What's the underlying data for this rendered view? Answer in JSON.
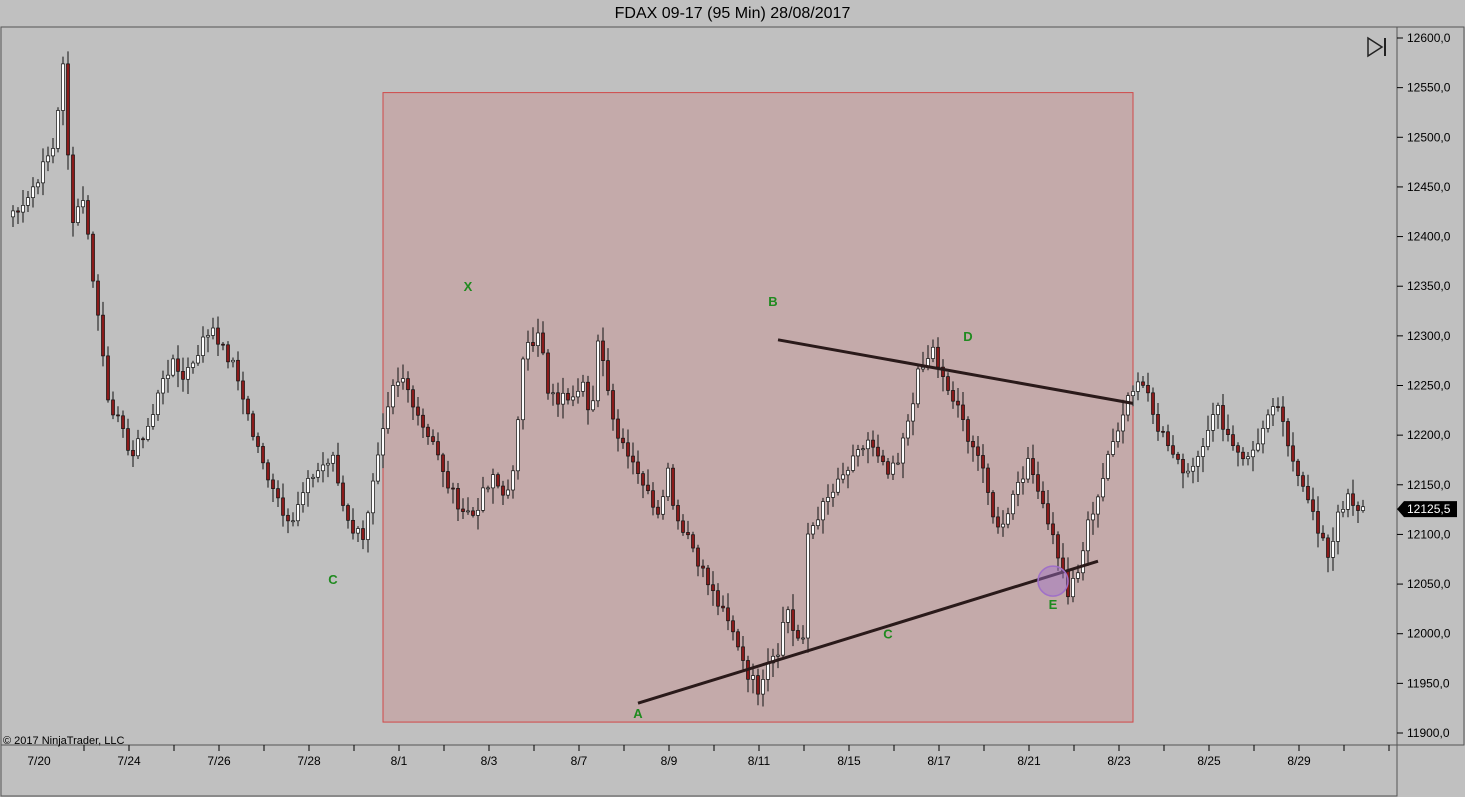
{
  "window": {
    "title": "FDAX 09-17 (95 Min)  28/08/2017"
  },
  "footer": {
    "copyright": "© 2017 NinjaTrader, LLC"
  },
  "icons": {
    "play_end": "skip-to-end-icon"
  },
  "colors": {
    "background": "#c0c0c0",
    "zone_fill": "#c4aaaa",
    "zone_border": "#d04848",
    "candle_up": "#ffffff",
    "candle_down": "#8b1a1a",
    "trendline": "#2a1a1a",
    "wave_label": "#1f8a1f",
    "marker": "#a070c8"
  },
  "chart_data": {
    "type": "candlestick",
    "title": "FDAX 09-17 (95 Min)  28/08/2017",
    "ylim": [
      11890,
      12615
    ],
    "yticks": [
      "12600,0",
      "12550,0",
      "12500,0",
      "12450,0",
      "12400,0",
      "12350,0",
      "12300,0",
      "12250,0",
      "12200,0",
      "12150,0",
      "12100,0",
      "12050,0",
      "12000,0",
      "11950,0",
      "11900,0"
    ],
    "ytick_values": [
      12600,
      12550,
      12500,
      12450,
      12400,
      12350,
      12300,
      12250,
      12200,
      12150,
      12100,
      12050,
      12000,
      11950,
      11900
    ],
    "xticks": [
      "7/20",
      "7/24",
      "7/26",
      "7/28",
      "8/1",
      "8/3",
      "8/7",
      "8/9",
      "8/11",
      "8/15",
      "8/17",
      "8/21",
      "8/23",
      "8/25",
      "8/29"
    ],
    "last_price": "12125,5",
    "grid": false,
    "price_path": [
      [
        0,
        12420
      ],
      [
        4,
        12440
      ],
      [
        7,
        12470
      ],
      [
        9,
        12490
      ],
      [
        10,
        12530
      ],
      [
        11,
        12570
      ],
      [
        12,
        12480
      ],
      [
        13,
        12420
      ],
      [
        15,
        12440
      ],
      [
        17,
        12360
      ],
      [
        18,
        12320
      ],
      [
        20,
        12240
      ],
      [
        23,
        12200
      ],
      [
        25,
        12180
      ],
      [
        27,
        12200
      ],
      [
        29,
        12220
      ],
      [
        31,
        12260
      ],
      [
        33,
        12270
      ],
      [
        35,
        12260
      ],
      [
        37,
        12275
      ],
      [
        39,
        12295
      ],
      [
        41,
        12310
      ],
      [
        43,
        12285
      ],
      [
        45,
        12270
      ],
      [
        47,
        12240
      ],
      [
        49,
        12200
      ],
      [
        51,
        12170
      ],
      [
        53,
        12150
      ],
      [
        55,
        12125
      ],
      [
        57,
        12115
      ],
      [
        59,
        12140
      ],
      [
        61,
        12160
      ],
      [
        63,
        12170
      ],
      [
        65,
        12175
      ],
      [
        67,
        12130
      ],
      [
        69,
        12105
      ],
      [
        71,
        12100
      ],
      [
        73,
        12150
      ],
      [
        75,
        12200
      ],
      [
        77,
        12245
      ],
      [
        79,
        12255
      ],
      [
        81,
        12235
      ],
      [
        83,
        12210
      ],
      [
        85,
        12195
      ],
      [
        87,
        12160
      ],
      [
        89,
        12140
      ],
      [
        91,
        12125
      ],
      [
        93,
        12120
      ],
      [
        95,
        12140
      ],
      [
        97,
        12155
      ],
      [
        99,
        12140
      ],
      [
        101,
        12160
      ],
      [
        102,
        12210
      ],
      [
        103,
        12280
      ],
      [
        104,
        12300
      ],
      [
        105,
        12295
      ],
      [
        106,
        12300
      ],
      [
        107,
        12280
      ],
      [
        108,
        12240
      ],
      [
        110,
        12235
      ],
      [
        112,
        12240
      ],
      [
        114,
        12250
      ],
      [
        115,
        12260
      ],
      [
        116,
        12225
      ],
      [
        117,
        12230
      ],
      [
        118,
        12290
      ],
      [
        119,
        12280
      ],
      [
        120,
        12245
      ],
      [
        122,
        12200
      ],
      [
        124,
        12185
      ],
      [
        126,
        12165
      ],
      [
        128,
        12140
      ],
      [
        130,
        12125
      ],
      [
        132,
        12165
      ],
      [
        133,
        12135
      ],
      [
        134,
        12115
      ],
      [
        136,
        12100
      ],
      [
        138,
        12075
      ],
      [
        140,
        12050
      ],
      [
        142,
        12030
      ],
      [
        144,
        12010
      ],
      [
        146,
        11990
      ],
      [
        148,
        11960
      ],
      [
        150,
        11945
      ],
      [
        152,
        11975
      ],
      [
        154,
        11985
      ],
      [
        155,
        12010
      ],
      [
        156,
        12025
      ],
      [
        157,
        12005
      ],
      [
        158,
        11995
      ],
      [
        159,
        11990
      ],
      [
        160,
        12100
      ],
      [
        162,
        12120
      ],
      [
        164,
        12135
      ],
      [
        166,
        12150
      ],
      [
        168,
        12165
      ],
      [
        170,
        12180
      ],
      [
        172,
        12195
      ],
      [
        174,
        12175
      ],
      [
        176,
        12160
      ],
      [
        178,
        12170
      ],
      [
        180,
        12215
      ],
      [
        182,
        12260
      ],
      [
        184,
        12275
      ],
      [
        185,
        12290
      ],
      [
        186,
        12265
      ],
      [
        188,
        12245
      ],
      [
        190,
        12225
      ],
      [
        192,
        12200
      ],
      [
        194,
        12180
      ],
      [
        196,
        12140
      ],
      [
        198,
        12105
      ],
      [
        200,
        12125
      ],
      [
        202,
        12155
      ],
      [
        204,
        12170
      ],
      [
        206,
        12150
      ],
      [
        208,
        12115
      ],
      [
        210,
        12080
      ],
      [
        212,
        12040
      ],
      [
        214,
        12060
      ],
      [
        216,
        12110
      ],
      [
        218,
        12140
      ],
      [
        220,
        12175
      ],
      [
        222,
        12210
      ],
      [
        224,
        12240
      ],
      [
        226,
        12255
      ],
      [
        228,
        12245
      ],
      [
        230,
        12210
      ],
      [
        232,
        12190
      ],
      [
        234,
        12170
      ],
      [
        236,
        12165
      ],
      [
        238,
        12180
      ],
      [
        240,
        12210
      ],
      [
        242,
        12225
      ],
      [
        244,
        12200
      ],
      [
        246,
        12185
      ],
      [
        248,
        12175
      ],
      [
        250,
        12195
      ],
      [
        252,
        12215
      ],
      [
        254,
        12230
      ],
      [
        256,
        12185
      ],
      [
        258,
        12165
      ],
      [
        260,
        12140
      ],
      [
        262,
        12100
      ],
      [
        264,
        12080
      ],
      [
        265,
        12095
      ],
      [
        266,
        12125
      ],
      [
        268,
        12135
      ],
      [
        270,
        12120
      ],
      [
        271,
        12125
      ]
    ],
    "wave_labels": [
      {
        "label": "C",
        "bar": 65,
        "price": 12050
      },
      {
        "label": "X",
        "bar": 92,
        "price": 12345
      },
      {
        "label": "B",
        "bar": 153,
        "price": 12330
      },
      {
        "label": "D",
        "bar": 192,
        "price": 12295
      },
      {
        "label": "A",
        "bar": 126,
        "price": 11915
      },
      {
        "label": "C",
        "bar": 176,
        "price": 11995
      },
      {
        "label": "E",
        "bar": 209,
        "price": 12025
      }
    ],
    "zone": {
      "x_start_bar": 75,
      "x_end_bar": 225,
      "price_high": 12545,
      "price_low": 11911
    },
    "trendlines": [
      {
        "from": {
          "bar": 154,
          "price": 12296
        },
        "to": {
          "bar": 225,
          "price": 12232
        }
      },
      {
        "from": {
          "bar": 126,
          "price": 11930
        },
        "to": {
          "bar": 218,
          "price": 12073
        }
      }
    ],
    "marker": {
      "bar": 209,
      "price": 12053
    }
  }
}
